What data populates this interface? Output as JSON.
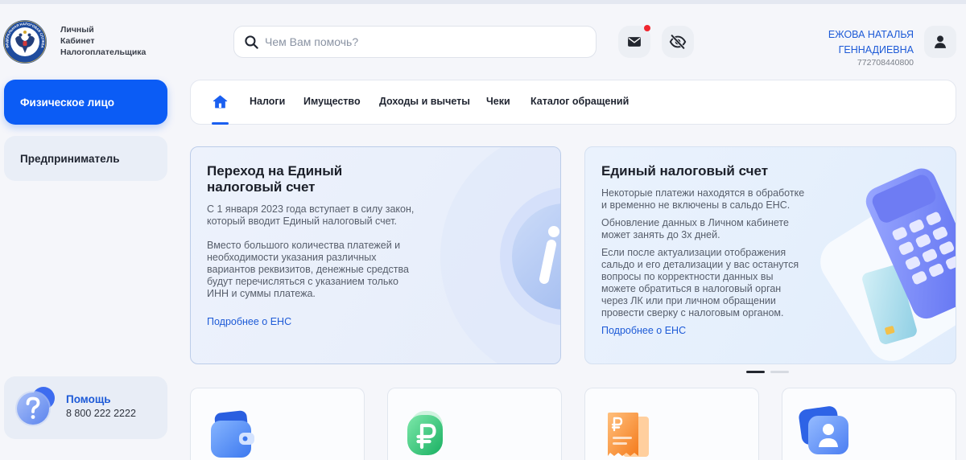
{
  "header": {
    "logo": {
      "icon": "fns-emblem-icon",
      "emblem_text": "ФЕДЕРАЛЬНАЯ НАЛОГОВАЯ СЛУЖБА",
      "title_lines": [
        "Личный",
        "Кабинет",
        "Налогоплательщика"
      ]
    },
    "search": {
      "icon": "search-icon",
      "placeholder": "Чем Вам помочь?",
      "value": ""
    },
    "actions": {
      "messages": {
        "icon": "mail-icon",
        "has_unread": true
      },
      "hide_amounts": {
        "icon": "eye-off-icon"
      }
    },
    "user": {
      "name_line1": "ЕЖОВА НАТАЛЬЯ",
      "name_line2": "ГЕННАДИЕВНА",
      "inn": "772708440800",
      "avatar_icon": "user-icon"
    }
  },
  "sidebar": {
    "items": [
      {
        "label": "Физическое лицо",
        "active": true
      },
      {
        "label": "Предприниматель",
        "active": false
      }
    ],
    "help": {
      "icon": "question-icon",
      "title": "Помощь",
      "phone": "8 800 222 2222"
    }
  },
  "nav": {
    "home": {
      "icon": "home-icon",
      "active": true
    },
    "items": [
      {
        "label": "Налоги"
      },
      {
        "label": "Имущество"
      },
      {
        "label": "Доходы и вычеты"
      },
      {
        "label": "Чеки"
      },
      {
        "label": "Каталог обращений"
      }
    ]
  },
  "banners": [
    {
      "title": "Переход на Единый\nналоговый счет",
      "paragraphs": [
        "С 1 января 2023 года вступает в силу закон,\nкоторый вводит Единый налоговый счет.",
        "Вместо большого количества платежей и\nнеобходимости указания различных\nвариантов реквизитов, денежные средства\nбудут перечисляться с указанием только\nИНН и суммы платежа."
      ],
      "link": "Подробнее о ЕНС",
      "illustration": "info-icon"
    },
    {
      "title": "Единый налоговый счет",
      "paragraphs": [
        "Некоторые платежи находятся в обработке\nи временно не включены в сальдо ЕНС.",
        "Обновление данных в Личном кабинете\nможет занять до 3х дней.",
        "Если после актуализации отображения\nсальдо и его детализации у вас останутся\nвопросы по корректности данных вы\nможете обратиться в налоговый орган\nчерез ЛК или при личном обращении\nпровести сверку с налоговым органом."
      ],
      "link": "Подробнее о ЕНС",
      "illustration": "payment-terminal-icon"
    }
  ],
  "carousel": {
    "slide_count": 2,
    "active_index": 0
  },
  "service_tiles": [
    {
      "icon": "wallet-icon"
    },
    {
      "icon": "ruble-icon"
    },
    {
      "icon": "receipt-icon"
    },
    {
      "icon": "profile-card-icon"
    }
  ],
  "colors": {
    "accent": "#0b5cf5",
    "link": "#1d5ad7",
    "notification": "#f0262f",
    "page_background": "#f5f6fa"
  }
}
